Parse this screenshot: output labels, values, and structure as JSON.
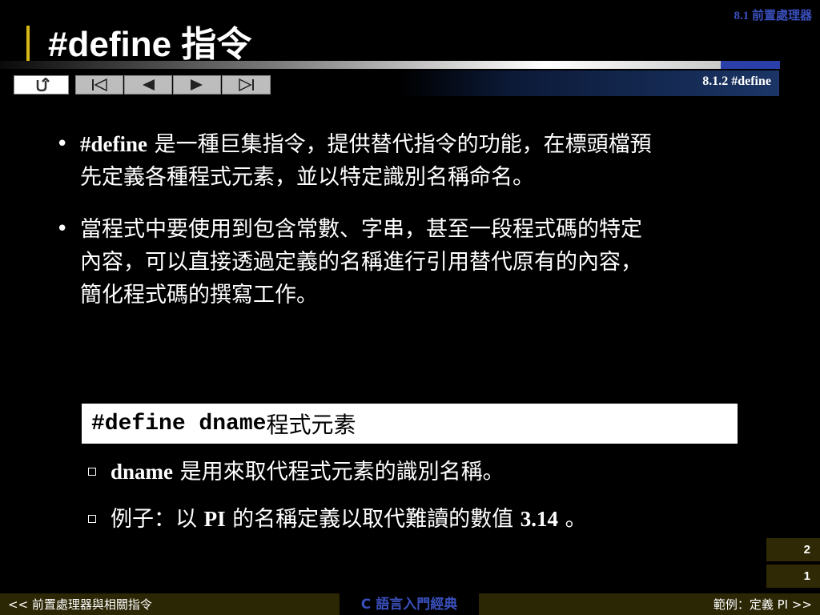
{
  "header": {
    "section": "8.1 前置處理器",
    "title": "#define 指令",
    "subsection": "8.1.2 #define"
  },
  "nav": {
    "home_icon": "return-arrow-icon",
    "first_icon": "first-slide-icon",
    "prev_icon": "previous-slide-icon",
    "next_icon": "next-slide-icon",
    "last_icon": "last-slide-icon"
  },
  "bullets": [
    {
      "bold": "#define",
      "text": " 是一種巨集指令，提供替代指令的功能，在標頭檔預先定義各種程式元素，並以特定識別名稱命名。"
    },
    {
      "bold": "",
      "text": "當程式中要使用到包含常數、字串，甚至一段程式碼的特定內容，可以直接透過定義的名稱進行引用替代原有的內容，簡化程式碼的撰寫工作。"
    }
  ],
  "code": {
    "directive": "#define dname",
    "tail": " 程式元素"
  },
  "sub_items": [
    {
      "bold1": "dname",
      "text1": " 是用來取代程式元素的識別名稱。",
      "bold2": "",
      "text2": ""
    },
    {
      "bold1": "",
      "text1": "例子：以 ",
      "bold2": "PI",
      "text2": " 的名稱定義以取代難讀的數值 ",
      "bold3": "3.14",
      "text3": " 。"
    }
  ],
  "page": {
    "top": "2",
    "bottom": "1"
  },
  "footer": {
    "left": "<< 前置處理器與相關指令",
    "center": "C 語言入門經典",
    "right": "範例：定義 PI >>"
  },
  "colors": {
    "accent_blue": "#3a4fbd",
    "title_bar_gold": "#d8b818",
    "footer_olive": "#2b2604"
  }
}
